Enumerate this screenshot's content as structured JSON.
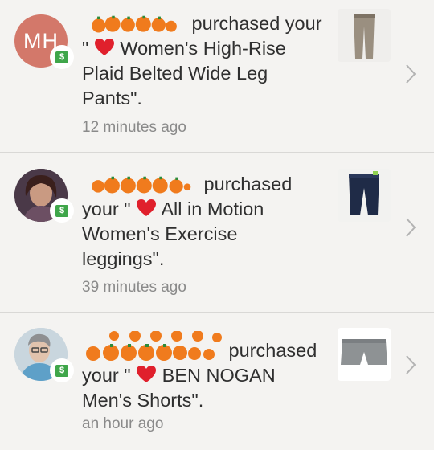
{
  "feed": {
    "items": [
      {
        "avatar_initials": "MH",
        "verb": "purchased your",
        "quote_open": "\"",
        "product": "Women's High-Rise Plaid Belted Wide Leg Pants",
        "quote_close": "\".",
        "time": "12 minutes ago"
      },
      {
        "verb": "purchased",
        "prefix": "your \"",
        "product": "All in Motion Women's Exercise leggings",
        "quote_close": "\".",
        "time": "39 minutes ago"
      },
      {
        "verb": "purchased",
        "prefix": "your \"",
        "product": "BEN NOGAN Men's Shorts",
        "quote_close": "\".",
        "time": "an hour ago"
      }
    ]
  },
  "icons": {
    "money": "money-icon",
    "heart": "heart-icon",
    "chevron": "chevron-right-icon"
  },
  "colors": {
    "background": "#f4f3f1",
    "avatar_initials_bg": "#d3786a",
    "money_green": "#3fa64a",
    "heart_red": "#e0202c",
    "scribble_orange": "#f07b1d",
    "time_gray": "#8a8a8a",
    "divider": "#d9d8d6"
  }
}
